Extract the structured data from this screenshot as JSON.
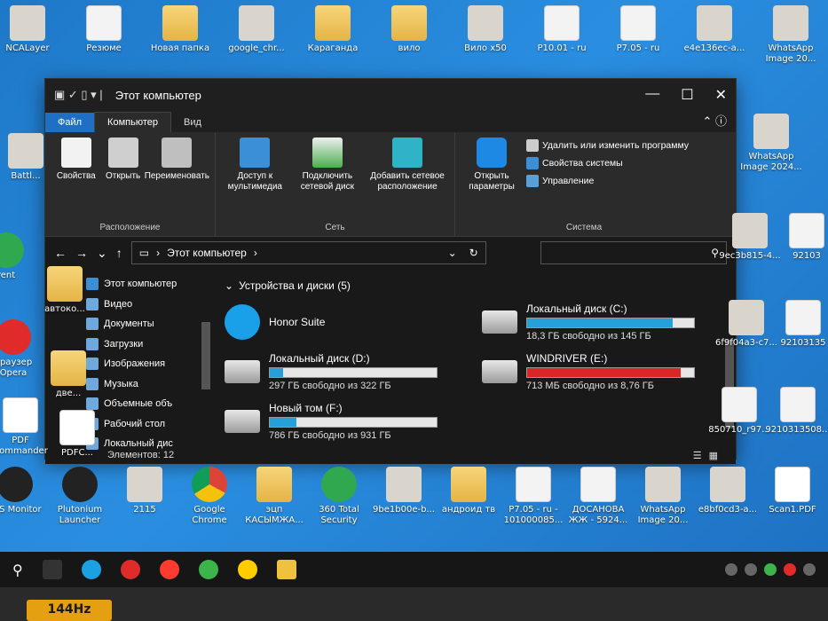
{
  "desktop": {
    "top_row": [
      {
        "label": "NCALayer",
        "icon": "ncalayer-icon"
      },
      {
        "label": "Резюме",
        "icon": "word-doc-icon"
      },
      {
        "label": "Новая папка",
        "icon": "folder-icon"
      },
      {
        "label": "google_chr...",
        "icon": "installer-icon"
      },
      {
        "label": "Караганда",
        "icon": "folder-icon"
      },
      {
        "label": "вило",
        "icon": "folder-icon"
      },
      {
        "label": "Вило х50",
        "icon": "image-icon"
      },
      {
        "label": "P10.01 - ru",
        "icon": "document-icon"
      },
      {
        "label": "P7.05 - ru",
        "icon": "document-icon"
      },
      {
        "label": "e4e136ec-a...",
        "icon": "image-icon"
      },
      {
        "label": "WhatsApp Image 20...",
        "icon": "image-icon"
      }
    ],
    "left_col": [
      {
        "label": "Battl...",
        "icon": "battle-icon"
      },
      {
        "label": "rent",
        "icon": "torrent-icon"
      },
      {
        "label": "автоко...",
        "icon": "folder-icon"
      },
      {
        "label": "браузер Opera",
        "icon": "opera-icon"
      },
      {
        "label": "две...",
        "icon": "folder-icon"
      },
      {
        "label": "PDF Commander",
        "icon": "pdf-commander-icon"
      },
      {
        "label": "PDFC...",
        "icon": "pdf-icon"
      }
    ],
    "right_col": [
      {
        "label": "WhatsApp Image 2024...",
        "icon": "image-icon"
      },
      {
        "label": "9ec3b815-4...",
        "icon": "image-icon"
      },
      {
        "label": "92103",
        "icon": "document-icon"
      },
      {
        "label": "6f9f04a3-c7...",
        "icon": "image-icon"
      },
      {
        "label": "92103135",
        "icon": "document-icon"
      },
      {
        "label": "850710_r97...",
        "icon": "document-icon"
      },
      {
        "label": "9210313508...",
        "icon": "document-icon"
      }
    ],
    "bottom_row": [
      {
        "label": "FPS Monitor",
        "icon": "fps-monitor-icon"
      },
      {
        "label": "Plutonium Launcher",
        "icon": "plutonium-icon"
      },
      {
        "label": "2115",
        "icon": "image-icon"
      },
      {
        "label": "Google Chrome",
        "icon": "chrome-icon"
      },
      {
        "label": "эцп КАСЫМЖА...",
        "icon": "folder-icon"
      },
      {
        "label": "360 Total Security",
        "icon": "360-security-icon"
      },
      {
        "label": "9be1b00e-b...",
        "icon": "image-icon"
      },
      {
        "label": "андроид тв",
        "icon": "folder-icon"
      },
      {
        "label": "P7.05 - ru - 101000085...",
        "icon": "document-icon"
      },
      {
        "label": "ДОСАНОВА ЖЖ - 5924...",
        "icon": "document-icon"
      },
      {
        "label": "WhatsApp Image 20...",
        "icon": "image-icon"
      },
      {
        "label": "e8bf0cd3-a...",
        "icon": "image-icon"
      },
      {
        "label": "Scan1.PDF",
        "icon": "pdf-icon"
      }
    ]
  },
  "window": {
    "title": "Этот компьютер",
    "tabs": {
      "file": "Файл",
      "computer": "Компьютер",
      "view": "Вид"
    },
    "ribbon": {
      "location": {
        "name": "Расположение",
        "properties": "Свойства",
        "open": "Открыть",
        "rename": "Переименовать"
      },
      "network": {
        "name": "Сеть",
        "media_access": "Доступ к мультимедиа",
        "map_drive": "Подключить сетевой диск",
        "add_location": "Добавить сетевое расположение"
      },
      "system": {
        "name": "Система",
        "open_settings": "Открыть параметры",
        "uninstall": "Удалить или изменить программу",
        "system_properties": "Свойства системы",
        "manage": "Управление"
      }
    },
    "address": {
      "path": "Этот компьютер",
      "search_placeholder": ""
    },
    "nav_pane": [
      {
        "label": "Этот компьютер",
        "icon": "computer-icon"
      },
      {
        "label": "Видео",
        "icon": "video-icon"
      },
      {
        "label": "Документы",
        "icon": "documents-icon"
      },
      {
        "label": "Загрузки",
        "icon": "downloads-icon"
      },
      {
        "label": "Изображения",
        "icon": "pictures-icon"
      },
      {
        "label": "Музыка",
        "icon": "music-icon"
      },
      {
        "label": "Объемные объ",
        "icon": "3d-objects-icon"
      },
      {
        "label": "Рабочий стол",
        "icon": "desktop-icon"
      },
      {
        "label": "Локальный дис",
        "icon": "drive-icon"
      }
    ],
    "section": "Устройства и диски (5)",
    "devices": {
      "honor": {
        "name": "Honor Suite"
      },
      "c": {
        "name": "Локальный диск (C:)",
        "free": "18,3 ГБ свободно из 145 ГБ",
        "used_fraction": 0.87
      },
      "d": {
        "name": "Локальный диск (D:)",
        "free": "297 ГБ свободно из 322 ГБ",
        "used_fraction": 0.08
      },
      "e": {
        "name": "WINDRIVER (E:)",
        "free": "713 МБ свободно из 8,76 ГБ",
        "used_fraction": 0.92
      },
      "f": {
        "name": "Новый том (F:)",
        "free": "786 ГБ свободно из 931 ГБ",
        "used_fraction": 0.16
      }
    },
    "status": "Элементов: 12"
  },
  "colors": {
    "accent": "#1f6fc4",
    "drive_bar": "#26a0da",
    "drive_bar_full": "#da2626"
  },
  "monitor_badge": "144Hz"
}
